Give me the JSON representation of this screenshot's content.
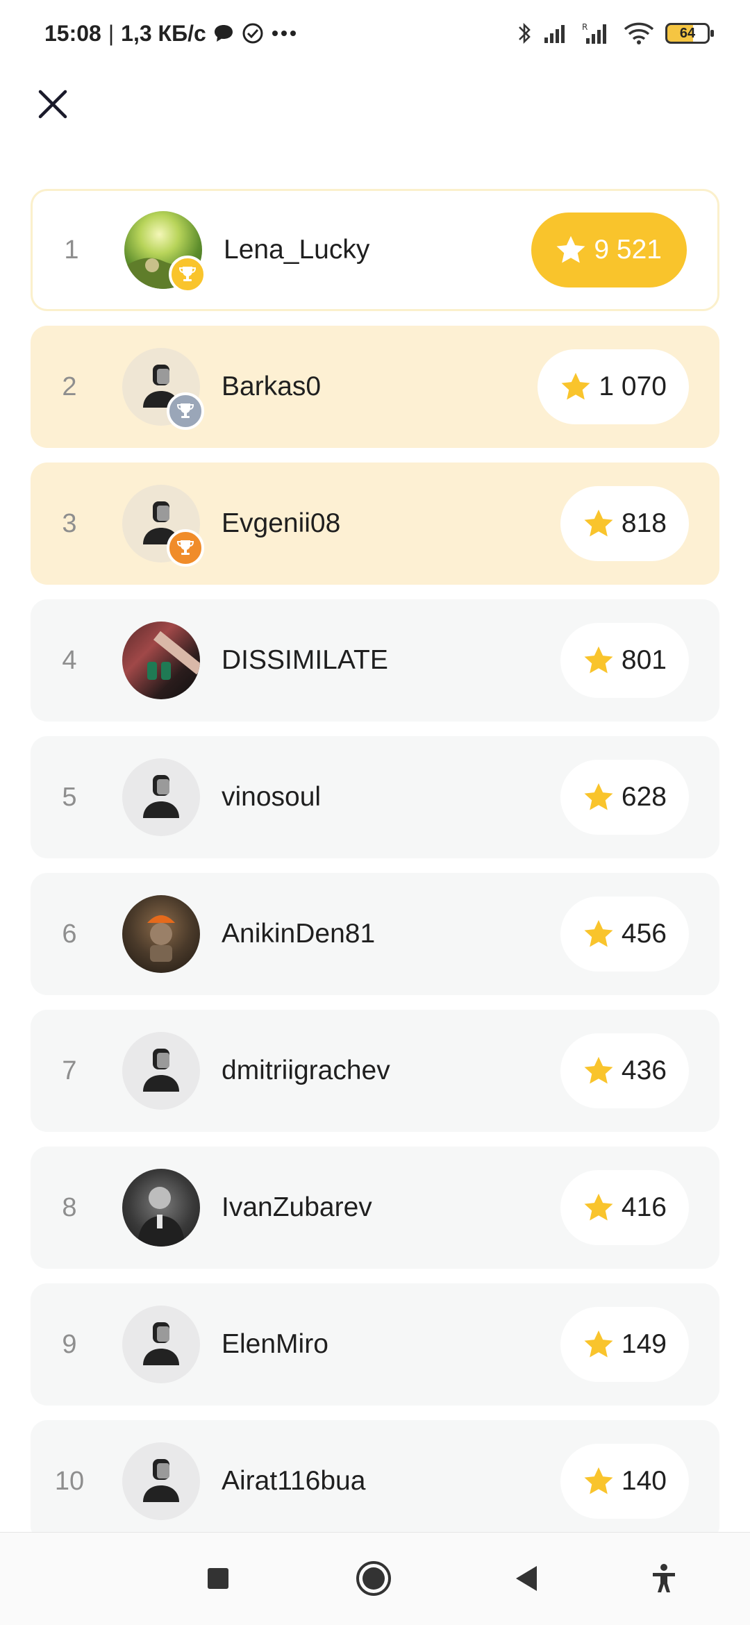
{
  "status_bar": {
    "time": "15:08",
    "net_speed": "1,3 КБ/с",
    "battery": "64"
  },
  "close": {
    "icon": "close-icon"
  },
  "leaderboard": [
    {
      "rank": "1",
      "name": "Lena_Lucky",
      "score": "9 521",
      "trophy": "gold"
    },
    {
      "rank": "2",
      "name": "Barkas0",
      "score": "1 070",
      "trophy": "silver"
    },
    {
      "rank": "3",
      "name": "Evgenii08",
      "score": "818",
      "trophy": "bronze"
    },
    {
      "rank": "4",
      "name": "DISSIMILATE",
      "score": "801"
    },
    {
      "rank": "5",
      "name": "vinosoul",
      "score": "628"
    },
    {
      "rank": "6",
      "name": "AnikinDen81",
      "score": "456"
    },
    {
      "rank": "7",
      "name": "dmitriigrachev",
      "score": "436"
    },
    {
      "rank": "8",
      "name": "IvanZubarev",
      "score": "416"
    },
    {
      "rank": "9",
      "name": "ElenMiro",
      "score": "149"
    },
    {
      "rank": "10",
      "name": "Airat116bua",
      "score": "140"
    }
  ],
  "colors": {
    "gold": "#f9c42c",
    "silver": "#9aa6b8",
    "bronze": "#f08c2a",
    "highlight": "#fdf0d3",
    "row": "#f6f7f7"
  },
  "nav_bar": {
    "icons": [
      "recents-square-icon",
      "home-circle-icon",
      "back-triangle-icon",
      "accessibility-icon"
    ]
  }
}
